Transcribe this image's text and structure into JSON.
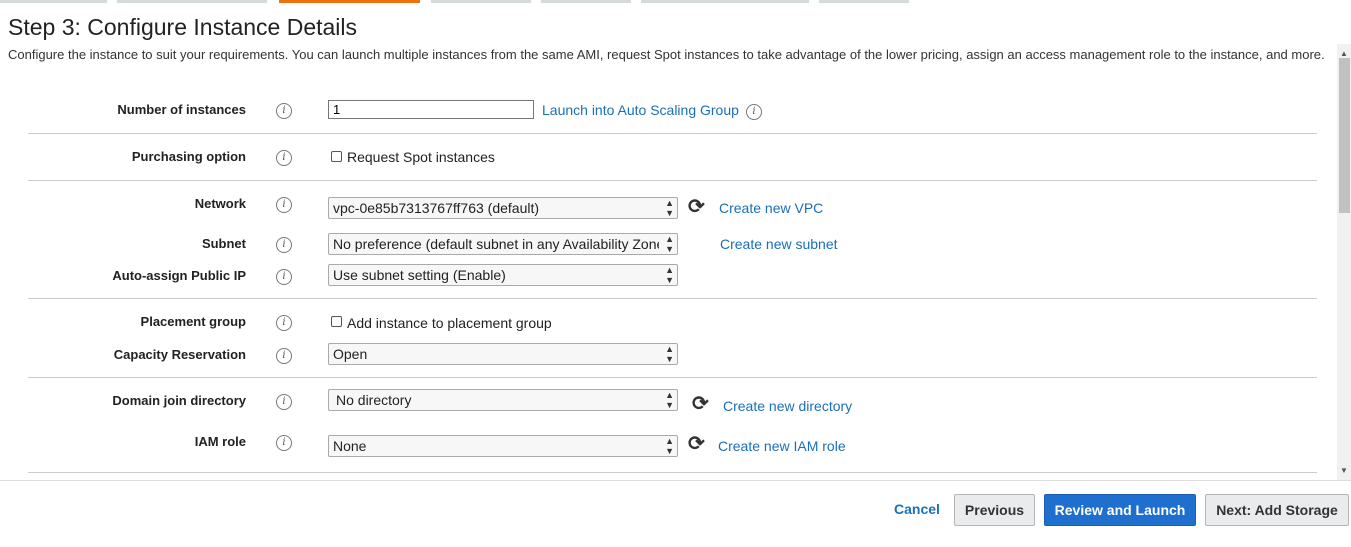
{
  "header": {
    "title": "Step 3: Configure Instance Details",
    "description": "Configure the instance to suit your requirements. You can launch multiple instances from the same AMI, request Spot instances to take advantage of the lower pricing, assign an access management role to the instance, and more."
  },
  "icons": {
    "info": "info-icon",
    "refresh": "refresh-icon"
  },
  "info_glyph": "i",
  "refresh_glyph": "⟳",
  "form": {
    "number_of_instances": {
      "label": "Number of instances",
      "value": "1",
      "link": "Launch into Auto Scaling Group"
    },
    "purchasing_option": {
      "label": "Purchasing option",
      "checkbox_label": "Request Spot instances",
      "checked": false
    },
    "network": {
      "label": "Network",
      "value": "vpc-0e85b7313767ff763 (default)",
      "link": "Create new VPC"
    },
    "subnet": {
      "label": "Subnet",
      "value": "No preference (default subnet in any Availability Zone)",
      "link": "Create new subnet"
    },
    "auto_assign_ip": {
      "label": "Auto-assign Public IP",
      "value": "Use subnet setting (Enable)"
    },
    "placement_group": {
      "label": "Placement group",
      "checkbox_label": "Add instance to placement group",
      "checked": false
    },
    "capacity_reservation": {
      "label": "Capacity Reservation",
      "value": "Open"
    },
    "domain_join": {
      "label": "Domain join directory",
      "value": "No directory",
      "link": "Create new directory"
    },
    "iam_role": {
      "label": "IAM role",
      "value": "None",
      "link": "Create new IAM role"
    }
  },
  "footer": {
    "cancel": "Cancel",
    "previous": "Previous",
    "review_launch": "Review and Launch",
    "next": "Next: Add Storage"
  },
  "colors": {
    "accent": "#ec7211",
    "link": "#1a6fba",
    "primary_button": "#1f6fcf"
  }
}
